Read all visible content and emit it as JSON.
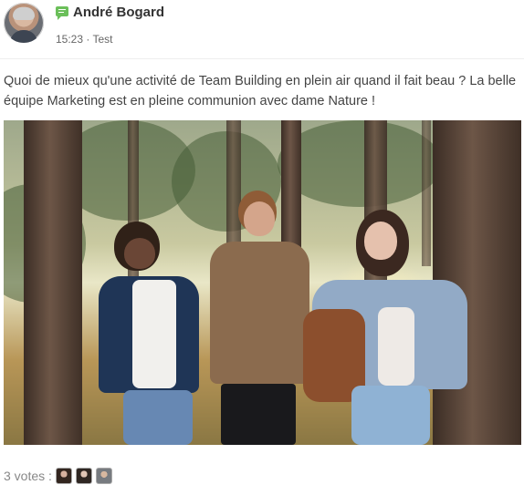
{
  "post": {
    "author": "André Bogard",
    "time": "15:23",
    "separator": "·",
    "category": "Test",
    "text": "Quoi de mieux qu'une activité de Team Building en plein air quand il fait beau ? La belle équipe Marketing est en pleine communion avec dame Nature !"
  },
  "photo": {
    "scene": "three people walking in a sunny forest"
  },
  "votes": {
    "label": "3 votes :",
    "count": 3
  },
  "icons": {
    "author_badge": "chat-bubble-icon",
    "avatar": "user-avatar"
  },
  "colors": {
    "badge_green": "#6bbf5a",
    "text_gray": "#444444",
    "meta_gray": "#666666"
  }
}
